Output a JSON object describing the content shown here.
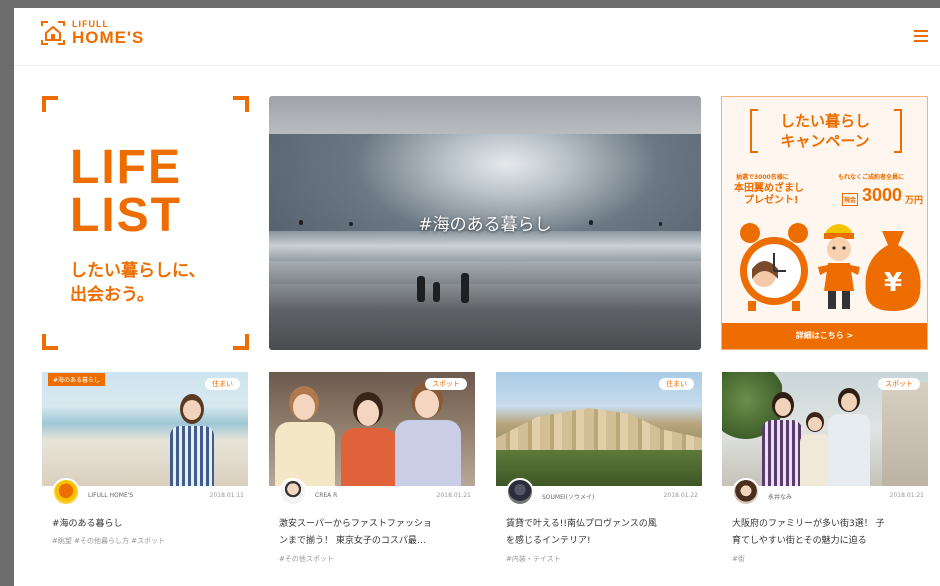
{
  "header": {
    "logo_small": "LIFULL",
    "logo_big": "HOME'S",
    "menu_icon": "hamburger-menu-icon"
  },
  "lifelist": {
    "title_line1": "LIFE",
    "title_line2": "LIST",
    "subtitle_line1": "したい暮らしに、",
    "subtitle_line2": "出会おう。"
  },
  "hero": {
    "caption": "#海のある暮らし"
  },
  "campaign": {
    "title_line1": "したい暮らし",
    "title_line2": "キャンペーン",
    "gift_line0": "抽選で3000名様に",
    "gift_line1": "本田翼めざまし",
    "gift_line2": "プレゼント!",
    "prize_note": "もれなくご成約者全員に",
    "prize_label": "現金",
    "amount": "3000",
    "unit": "万円",
    "footer": "詳細はこちら >"
  },
  "cards": [
    {
      "badge": "#海のある暮らし",
      "category": "住まい",
      "author": "LIFULL HOME'S",
      "date": "2018.01.11",
      "title_line1": "#海のある暮らし",
      "title_line2": "",
      "tags": "#眺望 #その他暮らし方 #スポット"
    },
    {
      "badge": "",
      "category": "スポット",
      "author": "CREA R",
      "date": "2018.01.21",
      "title_line1": "激安スーパーからファストファッショ",
      "title_line2": "ンまで揃う！ 東京女子のコスパ最…",
      "tags": "#その他スポット"
    },
    {
      "badge": "",
      "category": "住まい",
      "author": "SOUMEI(ソウメイ)",
      "date": "2018.01.22",
      "title_line1": "賃貸で叶える!!南仏プロヴァンスの風",
      "title_line2": "を感じるインテリア!",
      "tags": "#内装・テイスト"
    },
    {
      "badge": "",
      "category": "スポット",
      "author": "永井なみ",
      "date": "2018.01.21",
      "title_line1": "大阪府のファミリーが多い街3選！ 子",
      "title_line2": "育てしやすい街とその魅力に迫る",
      "tags": "#街"
    }
  ]
}
